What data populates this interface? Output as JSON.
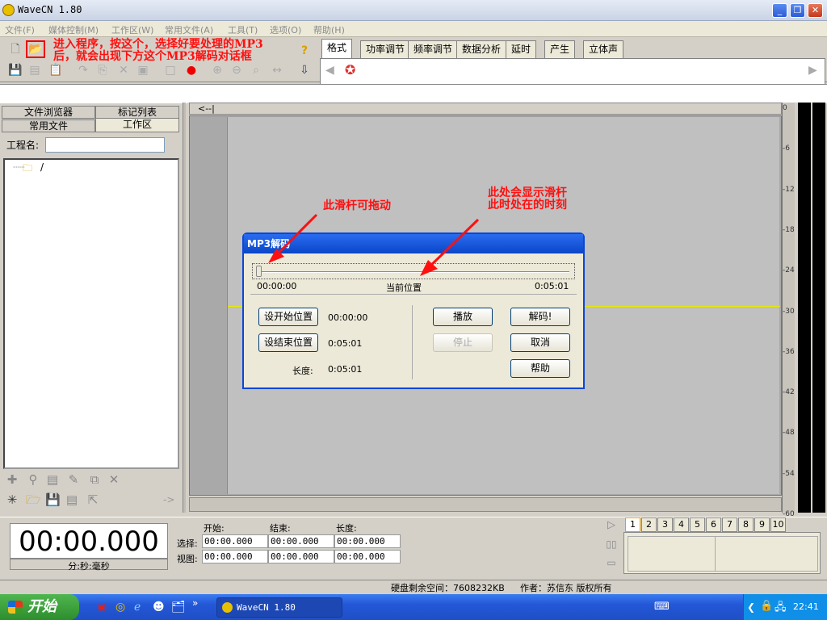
{
  "window": {
    "title": "WaveCN 1.80"
  },
  "menu": [
    "文件(F)",
    "媒体控制(M)",
    "工作区(W)",
    "常用文件(A)",
    "工具(T)",
    "选项(O)",
    "帮助(H)"
  ],
  "annotations": {
    "open_hint_line1": "进入程序，按这个，选择好要处理的MP3",
    "open_hint_line2": "后，就会出现下方这个MP3解码对话框",
    "slider_hint": "此滑杆可拖动",
    "time_hint_line1": "此处会显示滑杆",
    "time_hint_line2": "此时处在的时刻"
  },
  "tabs": [
    "格式",
    "功率调节",
    "频率调节",
    "数据分析",
    "延时",
    "产生",
    "立体声"
  ],
  "left_panel": {
    "tabs_top": [
      "文件浏览器",
      "标记列表"
    ],
    "tabs_bottom": [
      "常用文件",
      "工作区"
    ],
    "project_label": "工程名:",
    "project_value": "",
    "tree_root": "/",
    "nav_arrow": "->"
  },
  "wave": {
    "collapse_label": "<--|",
    "ruler_ticks": [
      "0",
      "-6",
      "-12",
      "-18",
      "-24",
      "-30",
      "-36",
      "-42",
      "-48",
      "-54",
      "-60"
    ]
  },
  "dialog": {
    "title": "MP3解码",
    "start_time": "00:00:00",
    "current_label": "当前位置",
    "end_time": "0:05:01",
    "slider_position": 0.0,
    "set_start_button": "设开始位置",
    "set_start_value": "00:00:00",
    "set_end_button": "设结束位置",
    "set_end_value": "0:05:01",
    "length_label": "长度:",
    "length_value": "0:05:01",
    "play_button": "播放",
    "stop_button": "停止",
    "decode_button": "解码!",
    "cancel_button": "取消",
    "help_button": "帮助"
  },
  "bottom": {
    "big_time": "00:00.000",
    "time_unit": "分:秒:毫秒",
    "col_start": "开始:",
    "col_end": "结束:",
    "col_length": "长度:",
    "row_select": "选择:",
    "row_view": "视图:",
    "sel_start": "00:00.000",
    "sel_end": "00:00.000",
    "sel_len": "00:00.000",
    "view_start": "00:00.000",
    "view_end": "00:00.000",
    "view_len": "00:00.000",
    "track_tabs": [
      "1",
      "2",
      "3",
      "4",
      "5",
      "6",
      "7",
      "8",
      "9",
      "10"
    ]
  },
  "status": {
    "disk_free": "硬盘剩余空间：7608232KB",
    "author": "作者：苏信东 版权所有"
  },
  "taskbar": {
    "start": "开始",
    "task": "WaveCN 1.80",
    "clock": "22:41"
  }
}
